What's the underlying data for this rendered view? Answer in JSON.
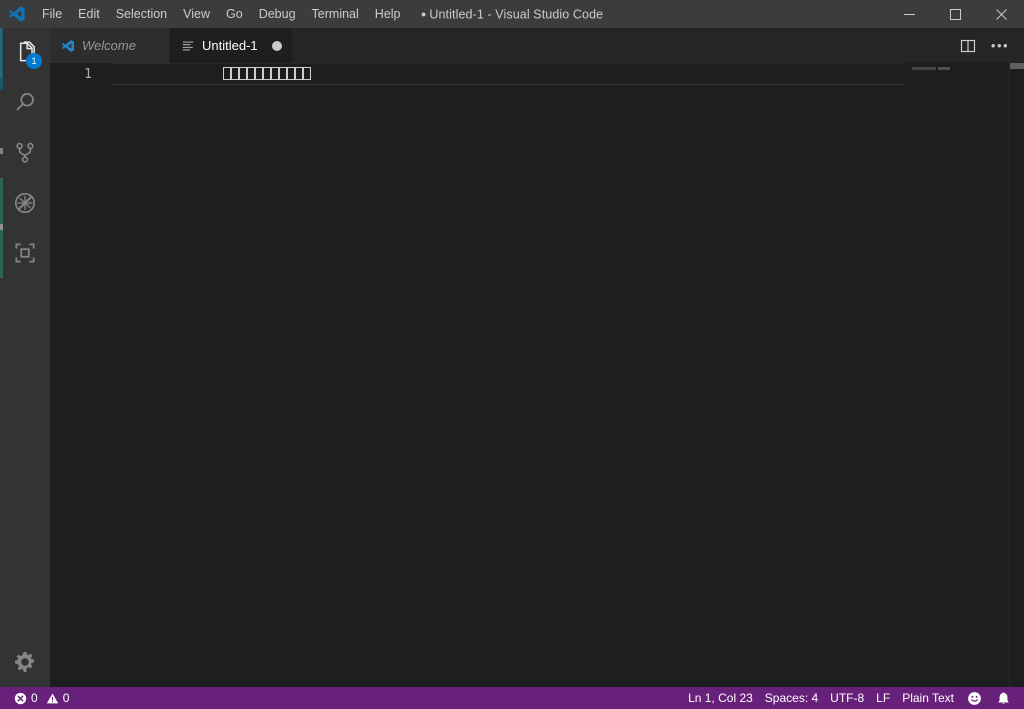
{
  "window": {
    "title": "Untitled-1 - Visual Studio Code",
    "dirty_indicator": "●",
    "logo_icon": "vscode-logo-icon",
    "controls": {
      "minimize": "minimize-icon",
      "maximize": "maximize-icon",
      "close": "close-icon"
    }
  },
  "menubar": {
    "items": [
      {
        "label": "File"
      },
      {
        "label": "Edit"
      },
      {
        "label": "Selection"
      },
      {
        "label": "View"
      },
      {
        "label": "Go"
      },
      {
        "label": "Debug"
      },
      {
        "label": "Terminal"
      },
      {
        "label": "Help"
      }
    ]
  },
  "activitybar": {
    "items": [
      {
        "name": "explorer",
        "icon": "files-icon",
        "active": true,
        "badge": "1"
      },
      {
        "name": "search",
        "icon": "search-icon",
        "active": false,
        "badge": ""
      },
      {
        "name": "source-control",
        "icon": "source-control-icon",
        "active": false,
        "badge": ""
      },
      {
        "name": "debug",
        "icon": "debug-no-icon",
        "active": false,
        "badge": ""
      },
      {
        "name": "extensions",
        "icon": "extensions-icon",
        "active": false,
        "badge": ""
      }
    ],
    "manage": {
      "name": "settings",
      "icon": "gear-icon"
    }
  },
  "tabs": [
    {
      "label": "Welcome",
      "icon": "vscode-logo-icon",
      "active": false,
      "dirty": false
    },
    {
      "label": "Untitled-1",
      "icon": "text-file-icon",
      "active": true,
      "dirty": true
    }
  ],
  "editor_actions": {
    "split": {
      "label": "Split Editor",
      "icon": "split-editor-icon"
    },
    "more": {
      "label": "•••",
      "icon": "more-actions-icon"
    }
  },
  "editor": {
    "line_number": "1",
    "line_text": "❑❑❑❑❑❑❑❑❑❑❑",
    "tofu_count": 11,
    "language_note": "unrenderable characters shown as placeholder boxes"
  },
  "statusbar": {
    "left": [
      {
        "name": "problems",
        "error_icon": "error-circle-icon",
        "error_count": "0",
        "warning_icon": "warning-triangle-icon",
        "warning_count": "0"
      }
    ],
    "right": [
      {
        "name": "cursor-position",
        "label": "Ln 1, Col 23"
      },
      {
        "name": "indentation",
        "label": "Spaces: 4"
      },
      {
        "name": "encoding",
        "label": "UTF-8"
      },
      {
        "name": "eol",
        "label": "LF"
      },
      {
        "name": "language-mode",
        "label": "Plain Text"
      },
      {
        "name": "feedback",
        "label": "",
        "icon": "smiley-icon"
      },
      {
        "name": "notifications",
        "label": "",
        "icon": "bell-icon"
      }
    ]
  },
  "colors": {
    "titlebar_bg": "#3c3c3c",
    "activitybar_bg": "#333333",
    "tabbar_bg": "#252526",
    "tab_inactive_bg": "#2d2d2d",
    "editor_bg": "#1e1e1e",
    "statusbar_bg": "#68217a",
    "badge_bg": "#007acc",
    "accent_blue": "#007acc",
    "foreground": "#cccccc"
  }
}
